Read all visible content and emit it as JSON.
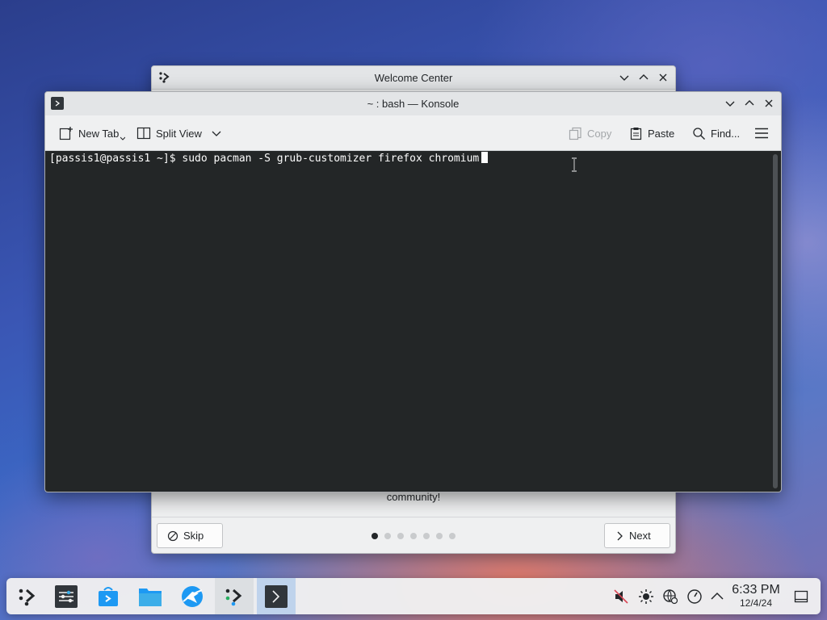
{
  "welcome": {
    "title": "Welcome Center",
    "body_text_tail": "community!",
    "skip_label": "Skip",
    "next_label": "Next",
    "page_count": 7,
    "current_page": 1
  },
  "konsole": {
    "title": "~ : bash — Konsole",
    "toolbar": {
      "new_tab": "New Tab",
      "split_view": "Split View",
      "copy": "Copy",
      "paste": "Paste",
      "find": "Find..."
    },
    "terminal": {
      "prompt": "[passis1@passis1 ~]$ ",
      "command": "sudo pacman -S grub-customizer firefox chromium"
    }
  },
  "taskbar": {
    "apps": [
      "application-launcher-icon",
      "system-settings-icon",
      "discover-store-icon",
      "dolphin-files-icon",
      "browser-icon",
      "welcome-center-icon",
      "konsole-icon"
    ],
    "tray": [
      "volume-muted-icon",
      "brightness-icon",
      "network-icon",
      "performance-icon",
      "show-hidden-chevron-icon"
    ],
    "time": "6:33 PM",
    "date": "12/4/24"
  },
  "colors": {
    "terminal_bg": "#232627",
    "accent": "#3daee9",
    "window_bg": "#eff0f1"
  }
}
